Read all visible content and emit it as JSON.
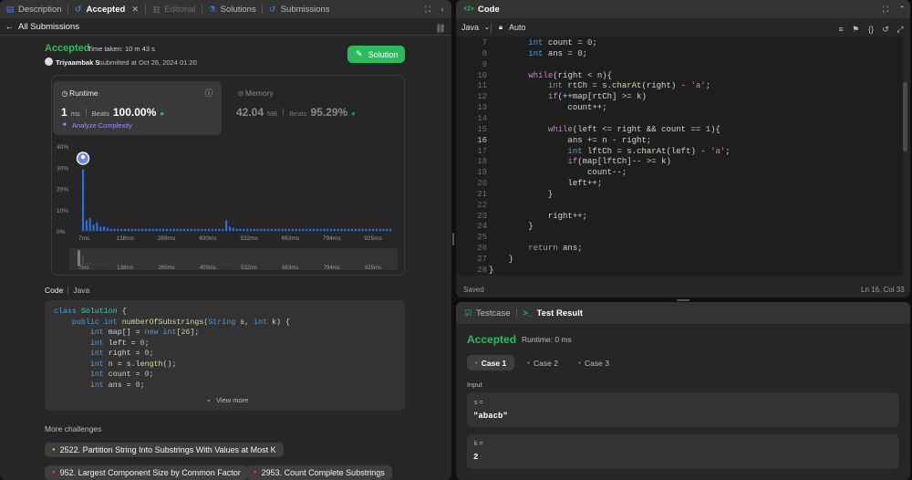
{
  "left_tabs": [
    {
      "label": "Description",
      "icon": "description-icon",
      "active": false
    },
    {
      "label": "Accepted",
      "icon": "history-icon",
      "active": true
    },
    {
      "label": "Editorial",
      "icon": "editorial-icon",
      "active": false
    },
    {
      "label": "Solutions",
      "icon": "flask-icon",
      "active": false
    },
    {
      "label": "Submissions",
      "icon": "history-icon",
      "active": false
    }
  ],
  "back_label": "All Submissions",
  "result": {
    "status": "Accepted",
    "time_taken": "Time taken: 10 m 43 s",
    "user": "Triyaambak S",
    "submitted": "submitted at Oct 26, 2024 01:20",
    "solution_button": "Solution"
  },
  "runtime": {
    "title": "Runtime",
    "value": "1",
    "unit": "ms",
    "beats_label": "Beats",
    "beats": "100.00%",
    "analyze": "Analyze Complexity"
  },
  "memory": {
    "title": "Memory",
    "value": "42.04",
    "unit": "MB",
    "beats_label": "Beats",
    "beats": "95.29%"
  },
  "chart_data": {
    "type": "bar",
    "y_ticks": [
      "40%",
      "30%",
      "20%",
      "10%",
      "0%"
    ],
    "ylim": [
      0,
      40
    ],
    "x_ticks": [
      "7ms",
      "138ms",
      "269ms",
      "400ms",
      "532ms",
      "663ms",
      "794ms",
      "925ms"
    ],
    "values": [
      29,
      5,
      6,
      3,
      4,
      2,
      2,
      1.5,
      1,
      1,
      1,
      1,
      1,
      1,
      1,
      1,
      1,
      1,
      1,
      1,
      1,
      1,
      1,
      1,
      1,
      1,
      1,
      1,
      1,
      1,
      1,
      1,
      1,
      1,
      1,
      1,
      1,
      1,
      1,
      1,
      1,
      5,
      2,
      1.5,
      1,
      1,
      1,
      1,
      1,
      1,
      1,
      1,
      1,
      1,
      1,
      1,
      1,
      1,
      1,
      1,
      1,
      1,
      1,
      1,
      1,
      1,
      1,
      1,
      1,
      1,
      1,
      1,
      1,
      1,
      1,
      1,
      1,
      1,
      1,
      1,
      1,
      1,
      1,
      1,
      1,
      1,
      1,
      1,
      1
    ],
    "highlight_index": 0,
    "color": "#2e6ee6"
  },
  "code_section": {
    "label": "Code",
    "lang": "Java",
    "view_more": "View more"
  },
  "snippet": [
    "class Solution {",
    "    public int numberOfSubstrings(String s, int k) {",
    "        int map[] = new int[26];",
    "        int left = 0;",
    "        int right = 0;",
    "        int n = s.length();",
    "        int count = 0;",
    "        int ans = 0;"
  ],
  "more_challenges": {
    "title": "More challenges",
    "items": [
      {
        "label": "2522. Partition String Into Substrings With Values at Most K",
        "color": "#ffb800"
      },
      {
        "label": "952. Largest Component Size by Common Factor",
        "color": "#f63737"
      },
      {
        "label": "2953. Count Complete Substrings",
        "color": "#f63737"
      }
    ]
  },
  "code_panel": {
    "title": "Code",
    "language": "Java",
    "mode": "Auto",
    "saved": "Saved",
    "cursor": "Ln 16, Col 33"
  },
  "editor_lines": [
    {
      "n": "7",
      "t": "        int count = 0;"
    },
    {
      "n": "8",
      "t": "        int ans = 0;"
    },
    {
      "n": "9",
      "t": ""
    },
    {
      "n": "10",
      "t": "        while(right < n){"
    },
    {
      "n": "11",
      "t": "            int rtCh = s.charAt(right) - 'a';"
    },
    {
      "n": "12",
      "t": "            if(++map[rtCh] >= k)"
    },
    {
      "n": "13",
      "t": "                count++;"
    },
    {
      "n": "14",
      "t": ""
    },
    {
      "n": "15",
      "t": "            while(left <= right && count == 1){"
    },
    {
      "n": "16",
      "t": "                ans += n - right;"
    },
    {
      "n": "17",
      "t": "                int lftCh = s.charAt(left) - 'a';"
    },
    {
      "n": "18",
      "t": "                if(map[lftCh]-- >= k)"
    },
    {
      "n": "19",
      "t": "                    count--;"
    },
    {
      "n": "20",
      "t": "                left++;"
    },
    {
      "n": "21",
      "t": "            }"
    },
    {
      "n": "22",
      "t": ""
    },
    {
      "n": "23",
      "t": "            right++;"
    },
    {
      "n": "24",
      "t": "        }"
    },
    {
      "n": "25",
      "t": ""
    },
    {
      "n": "26",
      "t": "        return ans;"
    },
    {
      "n": "27",
      "t": "    }"
    },
    {
      "n": "28",
      "t": "}"
    }
  ],
  "test_panel": {
    "tab_testcase": "Testcase",
    "tab_result": "Test Result",
    "status": "Accepted",
    "runtime": "Runtime: 0 ms",
    "cases": [
      "Case 1",
      "Case 2",
      "Case 3"
    ],
    "input_label": "Input",
    "inputs": [
      {
        "name": "s =",
        "value": "\"abacb\""
      },
      {
        "name": "k =",
        "value": "2"
      }
    ]
  }
}
